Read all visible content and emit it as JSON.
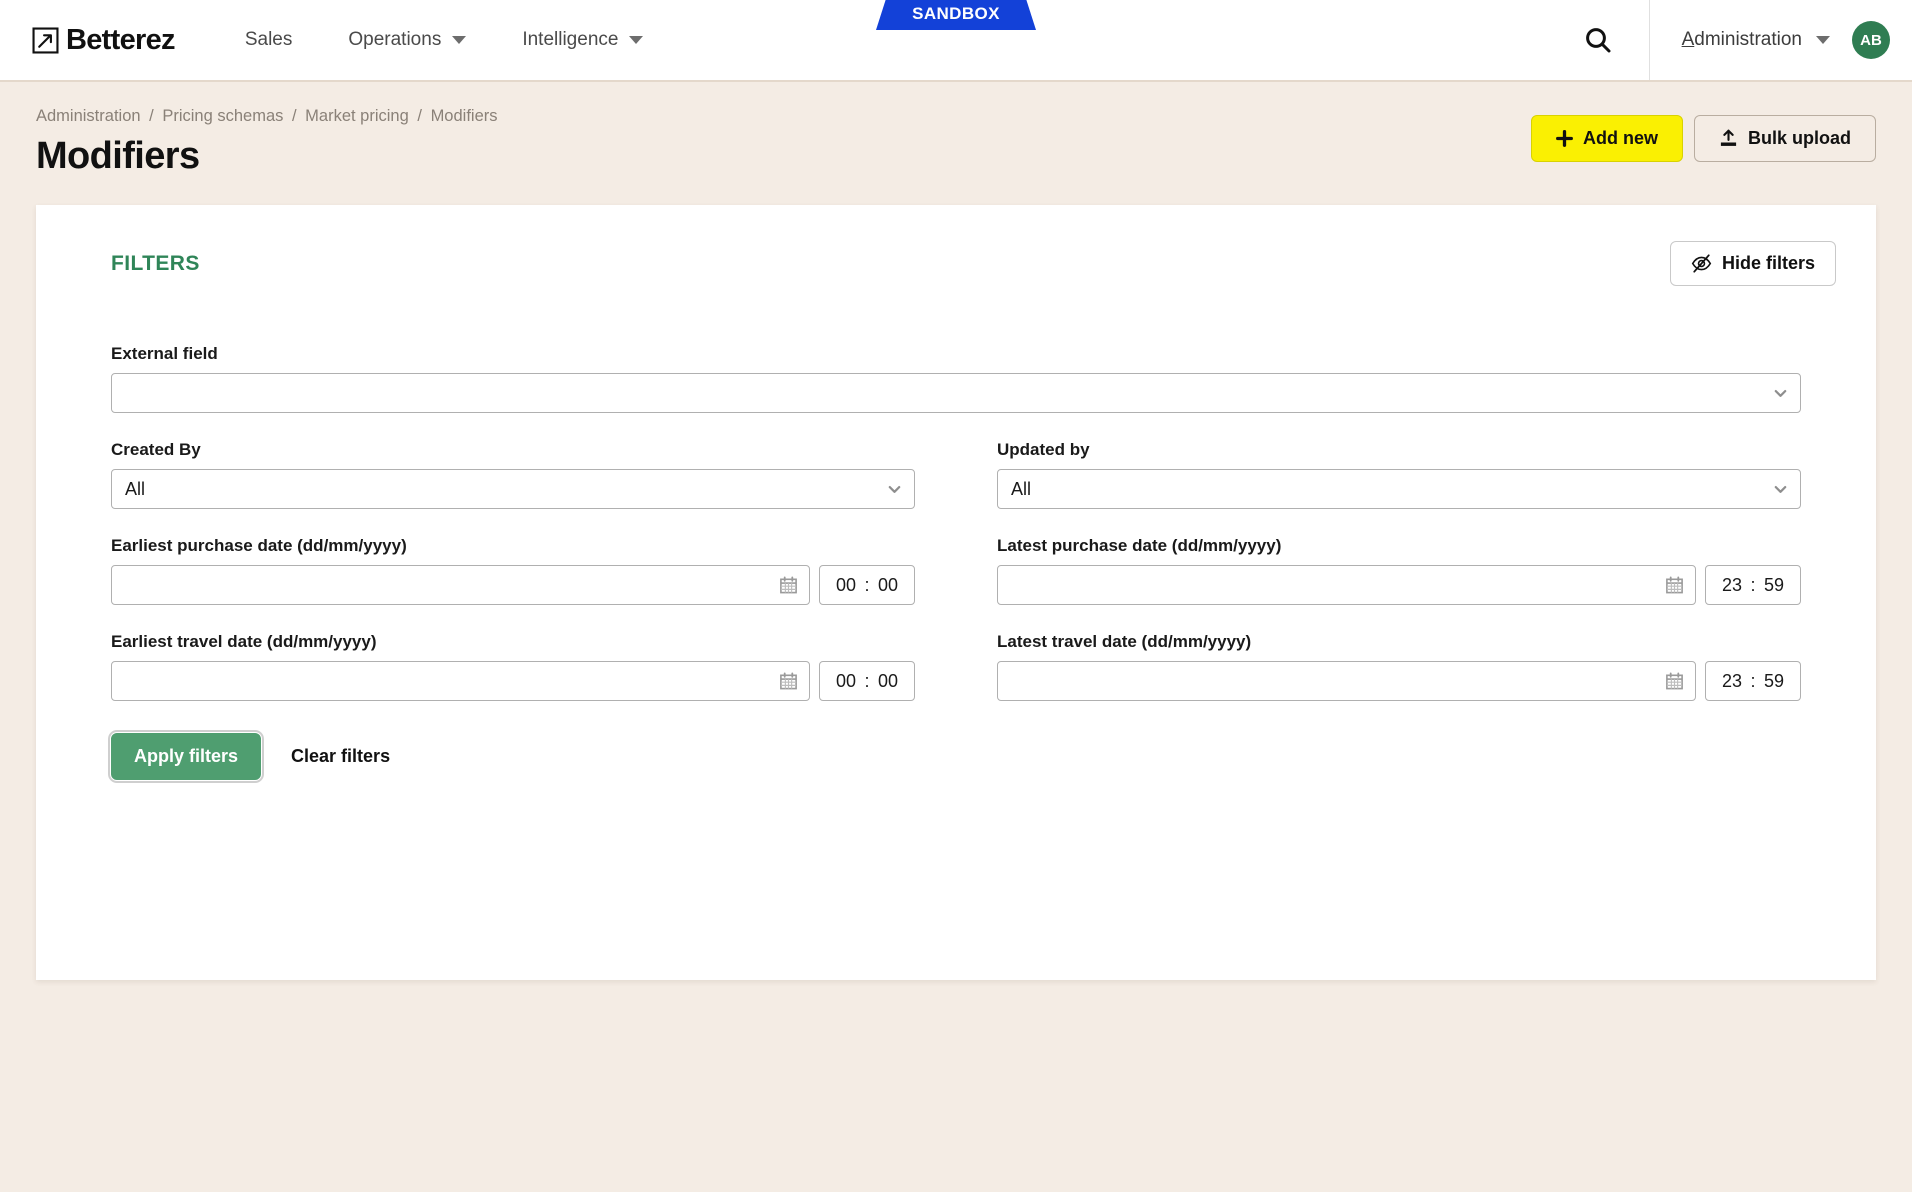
{
  "topnav": {
    "brand": "Betterez",
    "brand_icon": "arrow-up-right-square-icon",
    "links": [
      {
        "label": "Sales",
        "has_caret": false
      },
      {
        "label": "Operations",
        "has_caret": true
      },
      {
        "label": "Intelligence",
        "has_caret": true
      }
    ],
    "environment_badge": "SANDBOX",
    "search_icon": "search-icon",
    "account": {
      "label_accesskey": "A",
      "label_rest": "dministration",
      "avatar_initials": "AB"
    }
  },
  "page": {
    "breadcrumb": [
      "Administration",
      "Pricing schemas",
      "Market pricing",
      "Modifiers"
    ],
    "breadcrumb_separator": "/",
    "title": "Modifiers",
    "actions": {
      "add_new": "Add new",
      "add_new_icon": "plus-icon",
      "bulk_upload": "Bulk upload",
      "bulk_upload_icon": "upload-icon"
    }
  },
  "filters": {
    "heading": "FILTERS",
    "hide_button": "Hide filters",
    "hide_button_icon": "eye-slash-icon",
    "external_field": {
      "label": "External field",
      "value": "",
      "icon": "chevron-down-icon"
    },
    "created_by": {
      "label": "Created By",
      "value": "All",
      "icon": "chevron-down-icon"
    },
    "updated_by": {
      "label": "Updated by",
      "value": "All",
      "icon": "chevron-down-icon"
    },
    "earliest_purchase": {
      "label": "Earliest purchase date (dd/mm/yyyy)",
      "date": "",
      "calendar_icon": "calendar-icon",
      "hour": "00",
      "separator": ":",
      "minute": "00"
    },
    "latest_purchase": {
      "label": "Latest purchase date (dd/mm/yyyy)",
      "date": "",
      "calendar_icon": "calendar-icon",
      "hour": "23",
      "separator": ":",
      "minute": "59"
    },
    "earliest_travel": {
      "label": "Earliest travel date (dd/mm/yyyy)",
      "date": "",
      "calendar_icon": "calendar-icon",
      "hour": "00",
      "separator": ":",
      "minute": "00"
    },
    "latest_travel": {
      "label": "Latest travel date (dd/mm/yyyy)",
      "date": "",
      "calendar_icon": "calendar-icon",
      "hour": "23",
      "separator": ":",
      "minute": "59"
    },
    "apply_button": "Apply filters",
    "clear_button": "Clear filters"
  },
  "colors": {
    "page_background": "#f4ece4",
    "brand_green": "#2f8558",
    "apply_green": "#4f9e70",
    "accent_yellow": "#faf002",
    "sandbox_blue": "#1341d8",
    "card_white": "#ffffff"
  }
}
